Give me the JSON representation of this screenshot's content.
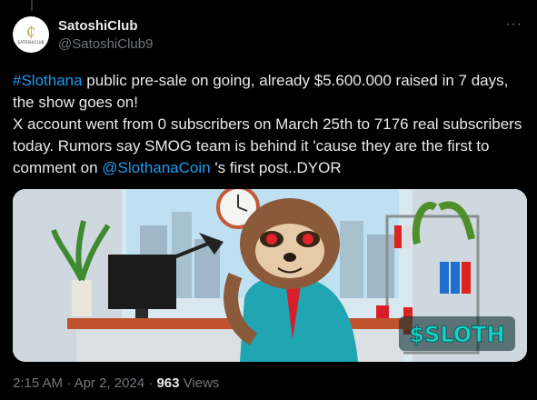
{
  "account": {
    "display_name": "SatoshiClub",
    "handle": "@SatoshiClub9",
    "avatar_glyph": "₵",
    "avatar_text": "SATOSHICLUB"
  },
  "menu": {
    "more_label": "···"
  },
  "tweet": {
    "hashtag": "#Slothana",
    "line1_rest": " public pre-sale on going, already $5.600.000 raised in 7 days, the show goes on!",
    "line2": "X account went from 0 subscribers on March 25th to 7176 real subscribers today. Rumors say SMOG team is behind it 'cause they are the first to comment on ",
    "mention": "@SlothanaCoin",
    "line2_end": " 's first post..DYOR"
  },
  "media": {
    "sign_text": "$SLOTH",
    "colors": {
      "sky": "#bfe0f0",
      "jacket": "#1fa6b2",
      "tie": "#d81e2a",
      "fur": "#8a5a3a",
      "sign": "#18d2c8"
    }
  },
  "meta": {
    "time": "2:15 AM",
    "separator": " · ",
    "date": "Apr 2, 2024",
    "views_count": "963",
    "views_label": " Views"
  },
  "colors": {
    "link": "#1d9bf0",
    "muted": "#71767b",
    "text": "#e7e9ea",
    "bg": "#000000"
  }
}
